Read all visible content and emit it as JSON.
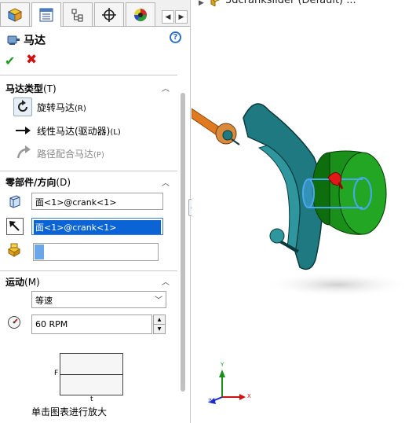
{
  "tabs": [
    "feature-manager",
    "property-manager",
    "configuration-manager",
    "dimxpert-manager",
    "display-manager"
  ],
  "tab_nav": {
    "left": "◀",
    "right": "▶"
  },
  "pm": {
    "title": "马达",
    "help": "?",
    "ok": "✔",
    "cancel": "✖"
  },
  "motor_type": {
    "header": "马达类型",
    "accel": "(T)",
    "options": [
      {
        "label": "旋转马达",
        "accel": "(R)",
        "enabled": true
      },
      {
        "label": "线性马达(驱动器)",
        "accel": "(L)",
        "enabled": true
      },
      {
        "label": "路径配合马达",
        "accel": "(P)",
        "enabled": false
      }
    ]
  },
  "component_direction": {
    "header": "零部件/方向",
    "accel": "(D)",
    "location_value": "面<1>@crank<1>",
    "direction_value": "面<1>@crank<1>",
    "component_value": ""
  },
  "motion": {
    "header": "运动",
    "accel": "(M)",
    "type_value": "等速",
    "speed_value": "60 RPM",
    "graph_y": "F",
    "graph_x": "t",
    "graph_caption": "单击图表进行放大"
  },
  "viewport": {
    "tree_title": "3dcrankslider (Default) ...",
    "triad": {
      "x": "X",
      "y": "Y",
      "z": "Z"
    }
  },
  "colors": {
    "accent": "#0a64d6",
    "part_teal": "#1e7a80",
    "part_green": "#1a8f1a",
    "rod_orange": "#e07a20"
  }
}
